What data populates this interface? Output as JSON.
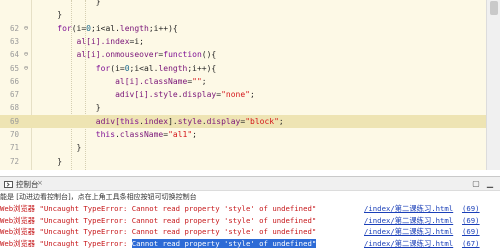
{
  "editor": {
    "lines": [
      {
        "n": "",
        "fold": "",
        "tokens": [
          {
            "t": "            }",
            "c": "pn"
          }
        ]
      },
      {
        "n": "",
        "fold": "",
        "tokens": [
          {
            "t": "    }",
            "c": "pn"
          }
        ]
      },
      {
        "n": "62",
        "fold": "⊖",
        "tokens": [
          {
            "t": "    for",
            "c": "kw"
          },
          {
            "t": "(i=",
            "c": "pn"
          },
          {
            "t": "0",
            "c": "num"
          },
          {
            "t": ";i<al.",
            "c": "pn"
          },
          {
            "t": "length",
            "c": "prop"
          },
          {
            "t": ";i++){",
            "c": "pn"
          }
        ]
      },
      {
        "n": "63",
        "fold": "",
        "tokens": [
          {
            "t": "        al[i].",
            "c": "id"
          },
          {
            "t": "index",
            "c": "prop"
          },
          {
            "t": "=i;",
            "c": "pn"
          }
        ]
      },
      {
        "n": "64",
        "fold": "⊖",
        "tokens": [
          {
            "t": "        al[i].",
            "c": "id"
          },
          {
            "t": "onmouseover",
            "c": "prop"
          },
          {
            "t": "=",
            "c": "pn"
          },
          {
            "t": "function",
            "c": "kw"
          },
          {
            "t": "(){",
            "c": "pn"
          }
        ]
      },
      {
        "n": "65",
        "fold": "⊖",
        "tokens": [
          {
            "t": "            for",
            "c": "kw"
          },
          {
            "t": "(i=",
            "c": "pn"
          },
          {
            "t": "0",
            "c": "num"
          },
          {
            "t": ";i<al.",
            "c": "pn"
          },
          {
            "t": "length",
            "c": "prop"
          },
          {
            "t": ";i++){",
            "c": "pn"
          }
        ]
      },
      {
        "n": "66",
        "fold": "",
        "tokens": [
          {
            "t": "                al[i].",
            "c": "id"
          },
          {
            "t": "className",
            "c": "prop"
          },
          {
            "t": "=",
            "c": "pn"
          },
          {
            "t": "\"\"",
            "c": "str"
          },
          {
            "t": ";",
            "c": "pn"
          }
        ]
      },
      {
        "n": "67",
        "fold": "",
        "tokens": [
          {
            "t": "                adiv[i].",
            "c": "id"
          },
          {
            "t": "style",
            "c": "prop"
          },
          {
            "t": ".",
            "c": "pn"
          },
          {
            "t": "display",
            "c": "prop"
          },
          {
            "t": "=",
            "c": "pn"
          },
          {
            "t": "\"none\"",
            "c": "str"
          },
          {
            "t": ";",
            "c": "pn"
          }
        ]
      },
      {
        "n": "68",
        "fold": "",
        "tokens": [
          {
            "t": "            }",
            "c": "pn"
          }
        ]
      },
      {
        "n": "69",
        "fold": "",
        "hl": true,
        "tokens": [
          {
            "t": "            adiv[",
            "c": "id"
          },
          {
            "t": "this",
            "c": "kw"
          },
          {
            "t": ".",
            "c": "pn"
          },
          {
            "t": "index",
            "c": "prop"
          },
          {
            "t": "].",
            "c": "pn"
          },
          {
            "t": "style",
            "c": "prop"
          },
          {
            "t": ".",
            "c": "pn"
          },
          {
            "t": "display",
            "c": "prop"
          },
          {
            "t": "=",
            "c": "pn"
          },
          {
            "t": "\"block\"",
            "c": "str"
          },
          {
            "t": ";",
            "c": "pn"
          }
        ]
      },
      {
        "n": "70",
        "fold": "",
        "tokens": [
          {
            "t": "            this",
            "c": "kw"
          },
          {
            "t": ".",
            "c": "pn"
          },
          {
            "t": "className",
            "c": "prop"
          },
          {
            "t": "=",
            "c": "pn"
          },
          {
            "t": "\"al1\"",
            "c": "str"
          },
          {
            "t": ";",
            "c": "pn"
          }
        ]
      },
      {
        "n": "71",
        "fold": "",
        "tokens": [
          {
            "t": "        }",
            "c": "pn"
          }
        ]
      },
      {
        "n": "72",
        "fold": "",
        "tokens": [
          {
            "t": "    }",
            "c": "pn"
          }
        ]
      },
      {
        "n": "73",
        "fold": "",
        "tokens": []
      },
      {
        "n": "74",
        "fold": "",
        "tokens": []
      }
    ]
  },
  "console": {
    "tab_label": "控制台",
    "close_glyph": "×",
    "hint": "能是 [动进边看控制台]，点在上角工具条相应按钮可切换控制台",
    "entries": [
      {
        "source": "Web浏览器",
        "prefix": "\"Uncaught TypeError: ",
        "message": "Cannot read property 'style' of undefined\"",
        "selected": false,
        "location": "/index/第二课练习.html",
        "count": "(69)"
      },
      {
        "source": "Web浏览器",
        "prefix": "\"Uncaught TypeError: ",
        "message": "Cannot read property 'style' of undefined\"",
        "selected": false,
        "location": "/index/第二课练习.html",
        "count": "(69)"
      },
      {
        "source": "Web浏览器",
        "prefix": "\"Uncaught TypeError: ",
        "message": "Cannot read property 'style' of undefined\"",
        "selected": false,
        "location": "/index/第二课练习.html",
        "count": "(69)"
      },
      {
        "source": "Web浏览器",
        "prefix": "\"Uncaught TypeError: ",
        "message": "Cannot read property 'style' of undefined\"",
        "selected": true,
        "location": "/index/第二课练习.html",
        "count": "(67)"
      }
    ]
  }
}
